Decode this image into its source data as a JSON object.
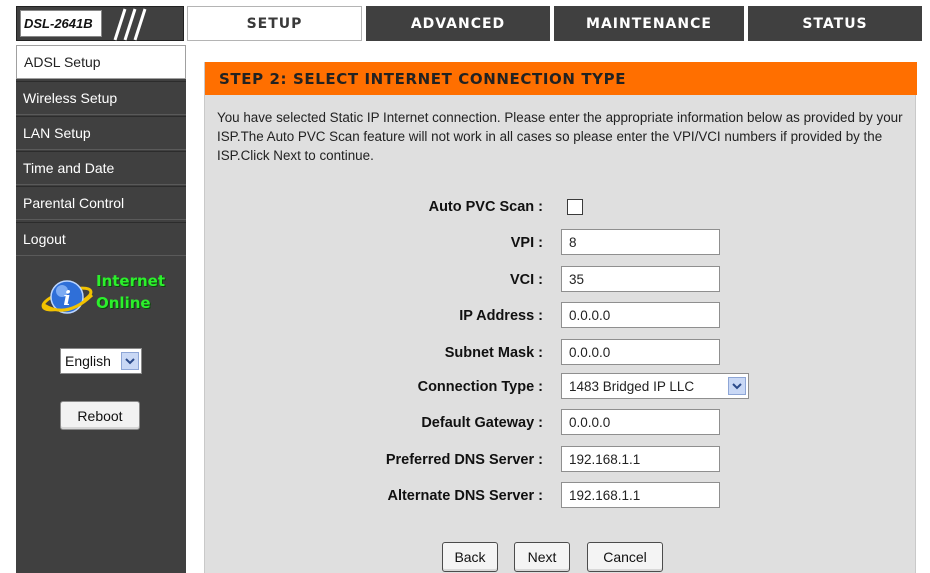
{
  "header": {
    "model": "DSL-2641B",
    "tabs": [
      {
        "label": "SETUP",
        "active": true
      },
      {
        "label": "ADVANCED",
        "active": false
      },
      {
        "label": "MAINTENANCE",
        "active": false
      },
      {
        "label": "STATUS",
        "active": false
      }
    ]
  },
  "sidebar": {
    "items": [
      {
        "label": "ADSL Setup",
        "active": true
      },
      {
        "label": "Wireless Setup",
        "active": false
      },
      {
        "label": "LAN Setup",
        "active": false
      },
      {
        "label": "Time and Date",
        "active": false
      },
      {
        "label": "Parental Control",
        "active": false
      },
      {
        "label": "Logout",
        "active": false
      }
    ],
    "status_line1": "Internet",
    "status_line2": "Online",
    "status_icon": "internet-globe-icon",
    "language": "English",
    "reboot_label": "Reboot"
  },
  "main": {
    "title": "STEP 2: SELECT INTERNET CONNECTION TYPE",
    "intro": "You have selected Static IP Internet connection. Please enter the appropriate information below as provided by your ISP.The Auto PVC Scan feature will not work in all cases so please enter the VPI/VCI numbers if provided by the ISP.Click Next to continue.",
    "form": {
      "auto_pvc_label": "Auto PVC Scan :",
      "auto_pvc_checked": false,
      "vpi_label": "VPI :",
      "vpi_value": "8",
      "vci_label": "VCI :",
      "vci_value": "35",
      "ip_label": "IP Address :",
      "ip_value": "0.0.0.0",
      "subnet_label": "Subnet Mask :",
      "subnet_value": "0.0.0.0",
      "conn_type_label": "Connection Type :",
      "conn_type_value": "1483 Bridged IP LLC",
      "gateway_label": "Default Gateway :",
      "gateway_value": "0.0.0.0",
      "dns1_label": "Preferred DNS Server :",
      "dns1_value": "192.168.1.1",
      "dns2_label": "Alternate DNS Server :",
      "dns2_value": "192.168.1.1"
    },
    "buttons": {
      "back": "Back",
      "next": "Next",
      "cancel": "Cancel"
    }
  },
  "colors": {
    "header_bar": "#404040",
    "accent_orange": "#ff6f00",
    "panel_bg": "#dfdfdf",
    "status_green": "#2cf02c"
  }
}
